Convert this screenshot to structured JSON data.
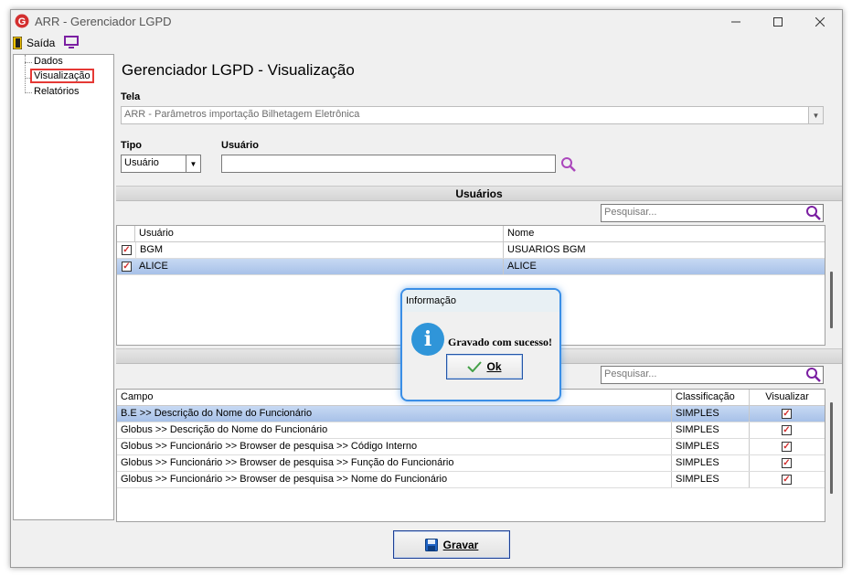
{
  "window": {
    "title": "ARR - Gerenciador LGPD",
    "min_icon": "minimize-icon",
    "max_icon": "maximize-icon",
    "close_icon": "close-icon"
  },
  "menu": {
    "exit_label": "Saída"
  },
  "sidebar": {
    "items": [
      {
        "label": "Dados"
      },
      {
        "label": "Visualização"
      },
      {
        "label": "Relatórios"
      }
    ]
  },
  "main": {
    "heading": "Gerenciador LGPD - Visualização",
    "tela_label": "Tela",
    "tela_value": "ARR - Parâmetros importação Bilhetagem Eletrônica",
    "tipo_label": "Tipo",
    "tipo_value": "Usuário",
    "usuario_label": "Usuário",
    "usuario_value": ""
  },
  "users_section": {
    "title": "Usuários",
    "search_placeholder": "Pesquisar...",
    "columns": [
      "Usuário",
      "Nome"
    ],
    "rows": [
      {
        "usuario": "BGM",
        "nome": "USUARIOS BGM",
        "checked": true
      },
      {
        "usuario": "ALICE",
        "nome": "ALICE",
        "checked": true
      }
    ]
  },
  "fields_section": {
    "search_placeholder": "Pesquisar...",
    "columns": [
      "Campo",
      "Classificação",
      "Visualizar"
    ],
    "rows": [
      {
        "campo": "B.E >> Descrição do Nome do Funcionário",
        "classificacao": "SIMPLES",
        "visualizar": true
      },
      {
        "campo": "Globus >> Descrição do Nome do Funcionário",
        "classificacao": "SIMPLES",
        "visualizar": true
      },
      {
        "campo": "Globus >> Funcionário >> Browser de pesquisa >> Código Interno",
        "classificacao": "SIMPLES",
        "visualizar": true
      },
      {
        "campo": "Globus >> Funcionário >> Browser de pesquisa >> Função do Funcionário",
        "classificacao": "SIMPLES",
        "visualizar": true
      },
      {
        "campo": "Globus >> Funcionário >> Browser de pesquisa >> Nome do Funcionário",
        "classificacao": "SIMPLES",
        "visualizar": true
      }
    ]
  },
  "footer": {
    "save_label": "Gravar"
  },
  "dialog": {
    "title": "Informação",
    "message": "Gravado com sucesso!",
    "ok_label": "Ok"
  },
  "colors": {
    "selection": "#b5cbee",
    "accent": "#3a8ee6",
    "check": "#d32f2f",
    "search_icon": "#7b1fa2"
  }
}
